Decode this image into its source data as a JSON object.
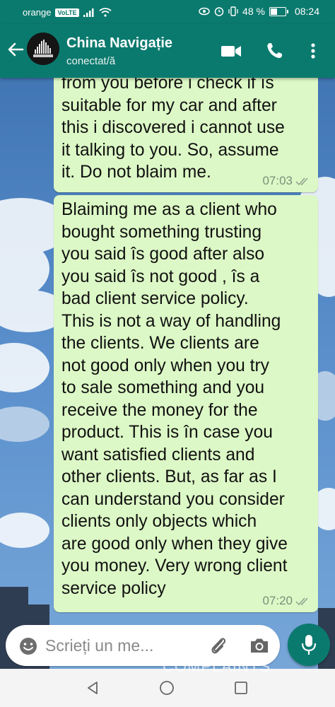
{
  "status_bar": {
    "carrier": "orange",
    "volte": "VoLTE",
    "battery": "48 %",
    "battery_level": 0.48,
    "time": "08:24"
  },
  "header": {
    "contact_name": "China Navigație",
    "contact_status": "conectat/ă",
    "avatar_icon": "kingdcats-logo"
  },
  "messages": [
    {
      "direction": "outgoing",
      "text": "from you before i check if îs\nsuitable for my car and after\nthis i discovered i cannot use\nit talking to you. So, assume\nit. Do not blaim me.",
      "time": "07:03",
      "status_icon": "double-check-icon"
    },
    {
      "direction": "outgoing",
      "text": "Blaiming me as a client who\nbought something trusting\nyou said îs good after also\nyou said îs not good , îs a\nbad client service policy.\nThis is not a way of handling\nthe clients. We clients are\nnot good only when you try\nto sale something and you\nreceive the  money for the\nproduct. This is în case you\nwant satisfied clients and\nother clients. But, as far as I\ncan understand you consider\nclients only objects which\nare good only when they give\nyou money. Very wrong client\nservice policy",
      "time": "07:20",
      "status_icon": "double-check-icon"
    }
  ],
  "input": {
    "placeholder": "Scrieți un me..."
  },
  "watermark": "COMPLAINTS",
  "colors": {
    "header": "#0b7a6e",
    "bubble": "#dcf8c6",
    "mic": "#0b7a6e"
  }
}
